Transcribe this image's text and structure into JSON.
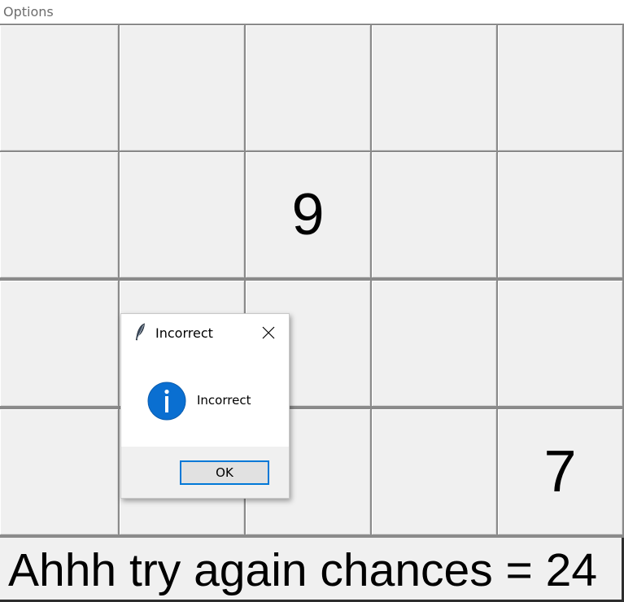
{
  "menubar": {
    "options_label": "Options"
  },
  "board": {
    "rows": 4,
    "cols": 5,
    "tiles": [
      [
        "",
        "",
        "",
        "",
        ""
      ],
      [
        "",
        "",
        "9",
        "",
        ""
      ],
      [
        "",
        "",
        "",
        "",
        ""
      ],
      [
        "",
        "",
        "",
        "",
        "7"
      ]
    ]
  },
  "status": {
    "text": "Ahhh try again chances = 24",
    "chances": 24
  },
  "dialog": {
    "title": "Incorrect",
    "message": "Incorrect",
    "ok_label": "OK",
    "title_icon": "feather-icon",
    "message_icon": "info-icon",
    "close_icon": "close-icon",
    "accent_color": "#0078d7"
  }
}
